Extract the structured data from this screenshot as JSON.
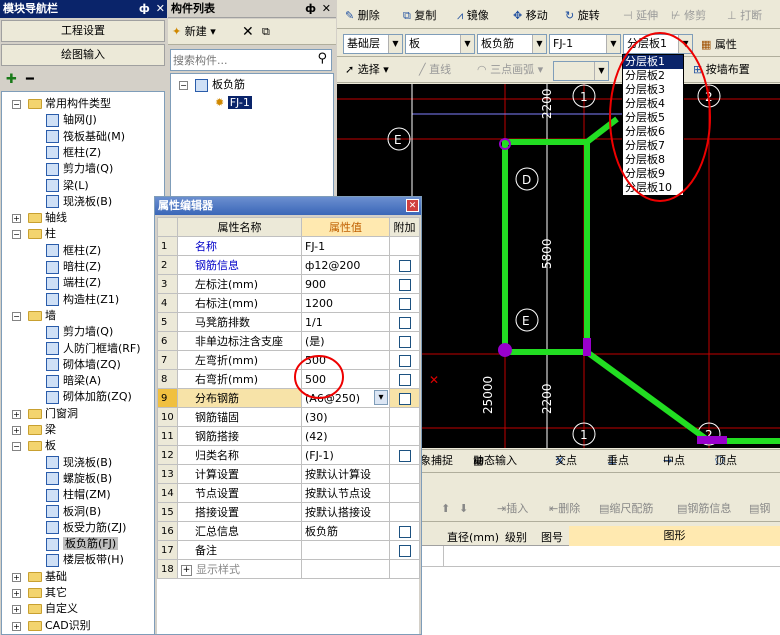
{
  "nav": {
    "title": "模块导航栏",
    "pin": "ф",
    "close": "✕",
    "btn_engineering": "工程设置",
    "btn_drawing": "绘图输入",
    "items": [
      {
        "label": "常用构件类型",
        "exp": "−",
        "type": "folder"
      },
      {
        "label": "轴网(J)",
        "type": "item"
      },
      {
        "label": "筏板基础(M)",
        "type": "item"
      },
      {
        "label": "框柱(Z)",
        "type": "item"
      },
      {
        "label": "剪力墙(Q)",
        "type": "item"
      },
      {
        "label": "梁(L)",
        "type": "item"
      },
      {
        "label": "现浇板(B)",
        "type": "item"
      },
      {
        "label": "轴线",
        "exp": "+",
        "type": "folder"
      },
      {
        "label": "柱",
        "exp": "−",
        "type": "folder"
      },
      {
        "label": "框柱(Z)",
        "type": "item"
      },
      {
        "label": "暗柱(Z)",
        "type": "item"
      },
      {
        "label": "端柱(Z)",
        "type": "item"
      },
      {
        "label": "构造柱(Z1)",
        "type": "item"
      },
      {
        "label": "墙",
        "exp": "−",
        "type": "folder"
      },
      {
        "label": "剪力墙(Q)",
        "type": "item"
      },
      {
        "label": "人防门框墙(RF)",
        "type": "item"
      },
      {
        "label": "砌体墙(ZQ)",
        "type": "item"
      },
      {
        "label": "暗梁(A)",
        "type": "item"
      },
      {
        "label": "砌体加筋(ZQ)",
        "type": "item"
      },
      {
        "label": "门窗洞",
        "exp": "+",
        "type": "folder"
      },
      {
        "label": "梁",
        "exp": "+",
        "type": "folder"
      },
      {
        "label": "板",
        "exp": "−",
        "type": "folder"
      },
      {
        "label": "现浇板(B)",
        "type": "item"
      },
      {
        "label": "螺旋板(B)",
        "type": "item"
      },
      {
        "label": "柱帽(ZM)",
        "type": "item"
      },
      {
        "label": "板洞(B)",
        "type": "item"
      },
      {
        "label": "板受力筋(ZJ)",
        "type": "item"
      },
      {
        "label": "板负筋(FJ)",
        "type": "item",
        "selected": true
      },
      {
        "label": "楼层板带(H)",
        "type": "item"
      },
      {
        "label": "基础",
        "exp": "+",
        "type": "folder"
      },
      {
        "label": "其它",
        "exp": "+",
        "type": "folder"
      },
      {
        "label": "自定义",
        "exp": "+",
        "type": "folder"
      },
      {
        "label": "CAD识别",
        "exp": "+",
        "type": "folder"
      }
    ]
  },
  "comp": {
    "title": "构件列表",
    "new_btn": "新建",
    "search_placeholder": "搜索构件...",
    "root": "板负筋",
    "child": "FJ-1"
  },
  "toolbar1": {
    "delete": "删除",
    "copy": "复制",
    "mirror": "镜像",
    "move": "移动",
    "rotate": "旋转",
    "extend": "延伸",
    "trim": "修剪",
    "break": "打断"
  },
  "toolbar2": {
    "floor": "基础层",
    "category": "板",
    "type": "板负筋",
    "name": "FJ-1",
    "layer": "分层板1",
    "attr_btn": "属性"
  },
  "toolbar3": {
    "select": "选择",
    "line": "直线",
    "arc": "三点画弧",
    "by_wall": "按墙布置"
  },
  "dropdown": {
    "options": [
      "分层板1",
      "分层板2",
      "分层板3",
      "分层板4",
      "分层板5",
      "分层板6",
      "分层板7",
      "分层板8",
      "分层板9",
      "分层板10"
    ]
  },
  "cad": {
    "dims": [
      "2200",
      "5800",
      "25000",
      "2200",
      "2200"
    ],
    "axis_labels": [
      "E",
      "D",
      "E",
      "1",
      "2",
      "1",
      "2"
    ]
  },
  "snapbar": {
    "obj_snap": "对象捕捉",
    "dyn_input": "动态输入",
    "intersection": "交点",
    "perpendicular": "垂点",
    "midpoint": "中点",
    "vertex": "顶点"
  },
  "rebar_bar": {
    "insert": "插入",
    "delete": "删除",
    "scale": "缩尺配筋",
    "info": "钢筋信息",
    "more": "钢"
  },
  "rebar_grid": {
    "headers": [
      "直径(mm)",
      "级别",
      "图号",
      "图形"
    ]
  },
  "prop": {
    "title": "属性编辑器",
    "col_name": "属性名称",
    "col_value": "属性值",
    "col_extra": "附加",
    "rows": [
      {
        "n": "1",
        "name": "名称",
        "value": "FJ-1",
        "blue": true,
        "chk": false
      },
      {
        "n": "2",
        "name": "钢筋信息",
        "value": "ф12@200",
        "blue": true,
        "chk": true
      },
      {
        "n": "3",
        "name": "左标注(mm)",
        "value": "900",
        "blue": false,
        "chk": true
      },
      {
        "n": "4",
        "name": "右标注(mm)",
        "value": "1200",
        "blue": false,
        "chk": true
      },
      {
        "n": "5",
        "name": "马凳筋排数",
        "value": "1/1",
        "blue": false,
        "chk": true
      },
      {
        "n": "6",
        "name": "非单边标注含支座",
        "value": "(是)",
        "blue": false,
        "chk": true
      },
      {
        "n": "7",
        "name": "左弯折(mm)",
        "value": "500",
        "blue": false,
        "chk": true
      },
      {
        "n": "8",
        "name": "右弯折(mm)",
        "value": "500",
        "blue": false,
        "chk": true
      },
      {
        "n": "9",
        "name": "分布钢筋",
        "value": "(A6@250)",
        "blue": false,
        "chk": true,
        "selected": true
      },
      {
        "n": "10",
        "name": "钢筋锚固",
        "value": "(30)",
        "blue": false,
        "chk": false
      },
      {
        "n": "11",
        "name": "钢筋搭接",
        "value": "(42)",
        "blue": false,
        "chk": false
      },
      {
        "n": "12",
        "name": "归类名称",
        "value": "(FJ-1)",
        "blue": false,
        "chk": true
      },
      {
        "n": "13",
        "name": "计算设置",
        "value": "按默认计算设",
        "blue": false,
        "chk": false
      },
      {
        "n": "14",
        "name": "节点设置",
        "value": "按默认节点设",
        "blue": false,
        "chk": false
      },
      {
        "n": "15",
        "name": "搭接设置",
        "value": "按默认搭接设",
        "blue": false,
        "chk": false
      },
      {
        "n": "16",
        "name": "汇总信息",
        "value": "板负筋",
        "blue": false,
        "chk": true
      },
      {
        "n": "17",
        "name": "备注",
        "value": "",
        "blue": false,
        "chk": true
      },
      {
        "n": "18",
        "name": "显示样式",
        "value": "",
        "blue": false,
        "chk": false,
        "group": true
      }
    ]
  }
}
